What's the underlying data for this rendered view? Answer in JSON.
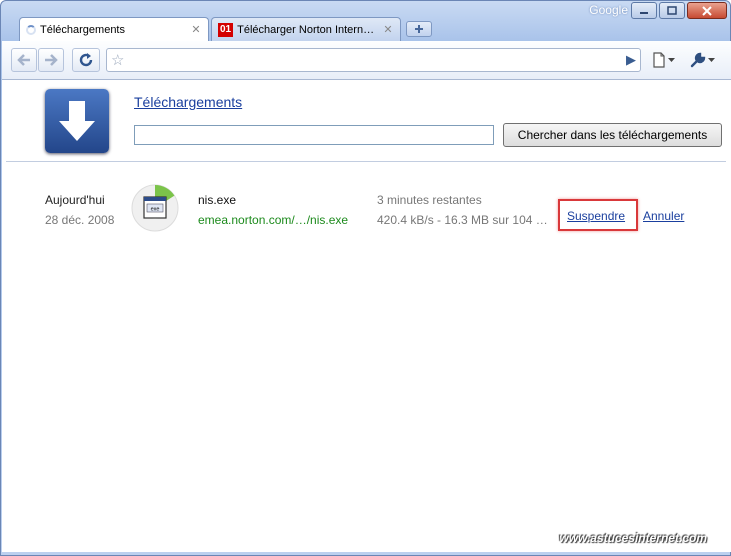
{
  "window": {
    "brand": "Google"
  },
  "tabs": [
    {
      "title": "Téléchargements"
    },
    {
      "title": "Télécharger Norton Intern…",
      "favicon_text": "01"
    }
  ],
  "toolbar": {
    "address_value": ""
  },
  "downloads_page": {
    "heading": "Téléchargements",
    "search_value": "",
    "search_button": "Chercher dans les téléchargements",
    "items": [
      {
        "date_label": "Aujourd'hui",
        "date": "28 déc. 2008",
        "filename": "nis.exe",
        "url": "emea.norton.com/…/nis.exe",
        "time_remaining": "3 minutes restantes",
        "progress_text": "420.4 kB/s - 16.3 MB sur 104 …",
        "pause_link": "Suspendre",
        "cancel_link": "Annuler",
        "progress_fraction": 0.16
      }
    ]
  },
  "watermark": "www.astucesinternet.com",
  "colors": {
    "link": "#1a3f9e",
    "url_green": "#1c8a1c",
    "highlight": "#d9383a"
  }
}
